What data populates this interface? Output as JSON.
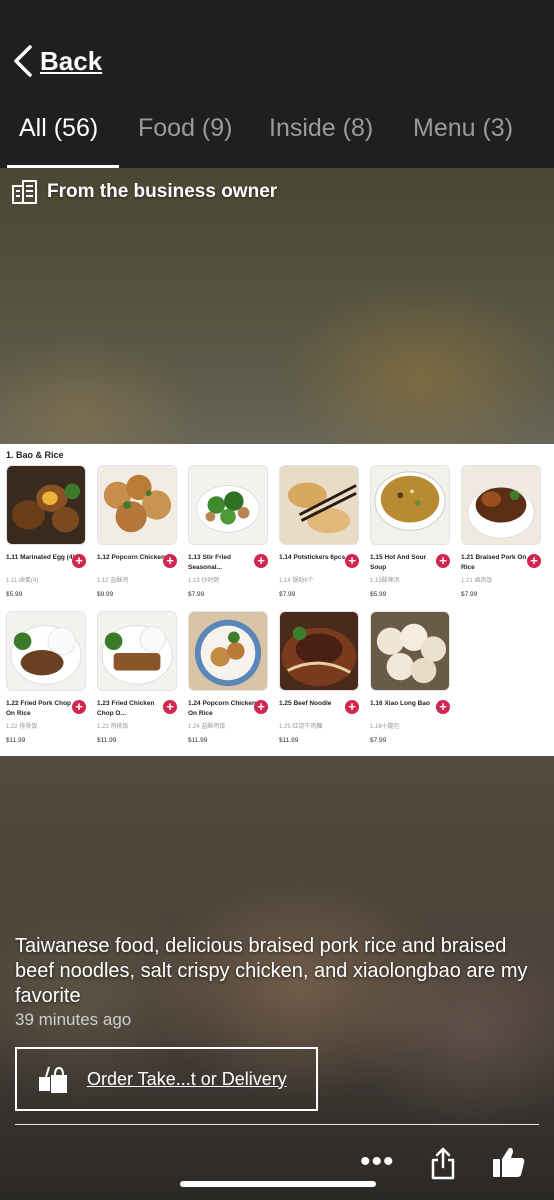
{
  "nav": {
    "back_label": "Back"
  },
  "tabs": [
    {
      "label": "All (56)",
      "active": true
    },
    {
      "label": "Food (9)",
      "active": false
    },
    {
      "label": "Inside (8)",
      "active": false
    },
    {
      "label": "Menu (3)",
      "active": false
    }
  ],
  "owner_label": "From the business owner",
  "menu": {
    "section_title": "1. Bao & Rice",
    "items": [
      {
        "name": "1.11 Marinated Egg (4)",
        "sub": "1.11 卤蛋(4)",
        "price": "$5.99"
      },
      {
        "name": "1.12 Popcorn Chicken",
        "sub": "1.12 盐酥鸡",
        "price": "$9.99"
      },
      {
        "name": "1.13 Stir Fried Seasonal...",
        "sub": "1.13 炒时蔬",
        "price": "$7.99"
      },
      {
        "name": "1.14 Potstickers 6pcs",
        "sub": "1.14 锅贴6个",
        "price": "$7.99"
      },
      {
        "name": "1.15 Hot And Sour Soup",
        "sub": "1.15酸辣汤",
        "price": "$5.99"
      },
      {
        "name": "1.21 Braised Pork On Rice",
        "sub": "1.21 卤肉饭",
        "price": "$7.99"
      },
      {
        "name": "1.22 Fried Pork Chop On Rice",
        "sub": "1.22 排骨饭",
        "price": "$11.99"
      },
      {
        "name": "1.23 Fried Chicken Chop O...",
        "sub": "1.23 鸡排饭",
        "price": "$11.99"
      },
      {
        "name": "1.24 Popcorn Chicken On Rice",
        "sub": "1.24 盐酥鸡饭",
        "price": "$11.99"
      },
      {
        "name": "1.25 Beef Noodle",
        "sub": "1.25 红烧牛肉麵",
        "price": "$11.99"
      },
      {
        "name": "1.16 Xiao Long Bao",
        "sub": "1.16小籠包",
        "price": "$7.99"
      }
    ]
  },
  "caption": "Taiwanese food, delicious braised pork rice and braised beef noodles, salt crispy chicken, and xiaolongbao are my favorite",
  "timestamp": "39 minutes ago",
  "order_label": "Order Take...t or Delivery",
  "icons": {
    "back": "chevron-left-icon",
    "owner": "building-icon",
    "order": "takeout-bag-icon",
    "more": "more-dots-icon",
    "share": "share-icon",
    "like": "thumbs-up-icon"
  },
  "colors": {
    "accent": "#d2254f",
    "header_bg": "#1f1f1f"
  }
}
